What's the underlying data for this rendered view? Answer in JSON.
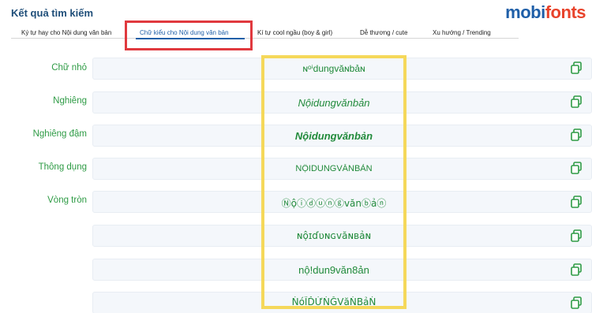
{
  "header": {
    "title": "Kết quả tìm kiếm",
    "logo_part1": "mobi",
    "logo_part2": "fonts"
  },
  "tabs": [
    {
      "label": "Ký tự hay cho Nội dung văn bản",
      "active": false
    },
    {
      "label": "Chữ kiểu cho Nội dung văn bản",
      "active": true
    },
    {
      "label": "Kí tự cool ngầu (boy & girl)",
      "active": false
    },
    {
      "label": "Dễ thương / cute",
      "active": false
    },
    {
      "label": "Xu hướng / Trending",
      "active": false
    }
  ],
  "rows": [
    {
      "label": "Chữ nhỏ",
      "value": "ɴᵒⁱdungvăɴbảɴ"
    },
    {
      "label": "Nghiêng",
      "value": "Nộidungvănbản"
    },
    {
      "label": "Nghiêng đậm",
      "value": "Nộidungvănbản"
    },
    {
      "label": "Thông dụng",
      "value": "NỘIDUNGVĂNBẢN"
    },
    {
      "label": "Vòng tròn",
      "value": "Ⓝộⓘⓓⓤⓝⓖvănⓑảⓝ"
    },
    {
      "label": "",
      "value": "ɴộɪɗʋɴɢvăɴвảɴ"
    },
    {
      "label": "",
      "value": "nộ!dun9văn8ản"
    },
    {
      "label": "",
      "value": "ŃóĨĎỨŃĞVăŃBảŃ"
    }
  ],
  "colors": {
    "accent_green": "#2e9b45",
    "brand_blue": "#1f5fa8",
    "brand_red": "#e8432b",
    "highlight_red": "#e0393e",
    "highlight_yellow": "#f5d85a"
  },
  "icons": {
    "copy": "copy-icon"
  }
}
